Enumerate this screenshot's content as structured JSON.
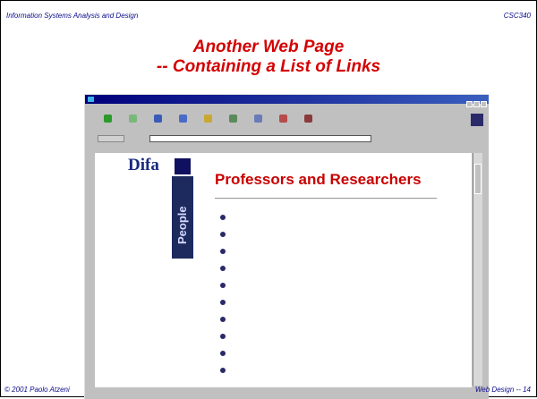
{
  "slide": {
    "header_left": "Information Systems Analysis and Design",
    "header_right": "CSC340",
    "title_line1": "Another Web Page",
    "title_line2": "-- Containing a List of Links",
    "footer_left": "© 2001 Paolo Atzeni",
    "footer_right": "Web Design -- 14"
  },
  "colors": {
    "title": "#d40000",
    "header_text": "#0a0a8a",
    "page_heading": "#c80000",
    "link": "#1a1aa8",
    "window_chrome": "#c0c0c0"
  },
  "browser": {
    "icons": [
      "back-icon",
      "forward-icon",
      "reload-icon",
      "home-icon",
      "search-icon",
      "guide-icon",
      "print-icon",
      "security-icon",
      "stop-icon"
    ],
    "page": {
      "logo_text": "Difa",
      "side_label": "People",
      "heading": "Professors and Researchers"
    }
  }
}
